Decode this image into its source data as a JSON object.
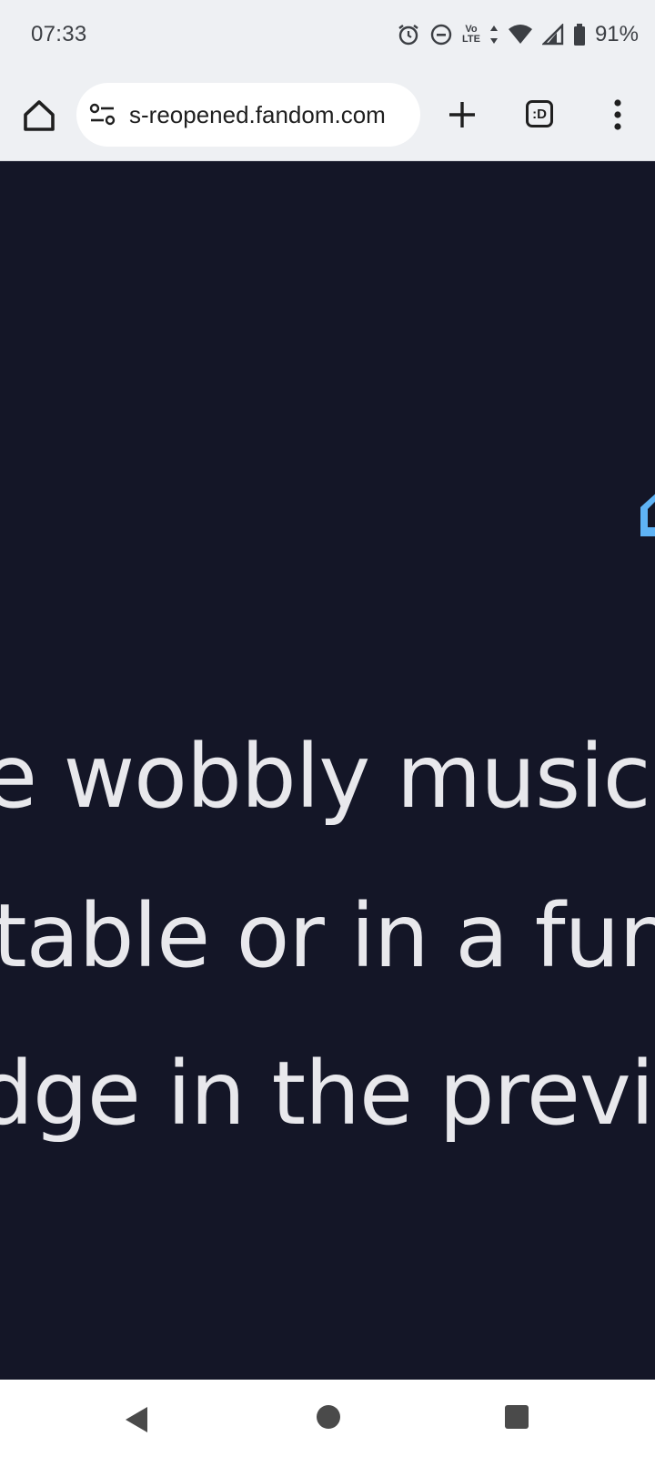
{
  "status_bar": {
    "time": "07:33",
    "volte_line1": "Vo",
    "volte_line2": "LTE",
    "battery_percent": "91%",
    "icons": [
      "alarm-icon",
      "dnd-icon",
      "volte-icon",
      "data-arrows-icon",
      "wifi-icon",
      "signal-icon",
      "battery-icon"
    ]
  },
  "browser": {
    "url": "s-reopened.fandom.com",
    "tab_count": ":D",
    "icons": [
      "home-icon",
      "site-settings-icon",
      "new-tab-icon",
      "tab-switcher-icon",
      "more-menu-icon"
    ]
  },
  "page": {
    "lines": [
      "e wobbly music, v",
      "table or in a func",
      "dge in the previo"
    ],
    "accent_color": "#5fb3f5",
    "text_color": "#e8e8ec",
    "background_color": "#141627"
  },
  "nav": {
    "icons": [
      "back-icon",
      "home-circle-icon",
      "recents-icon"
    ]
  }
}
